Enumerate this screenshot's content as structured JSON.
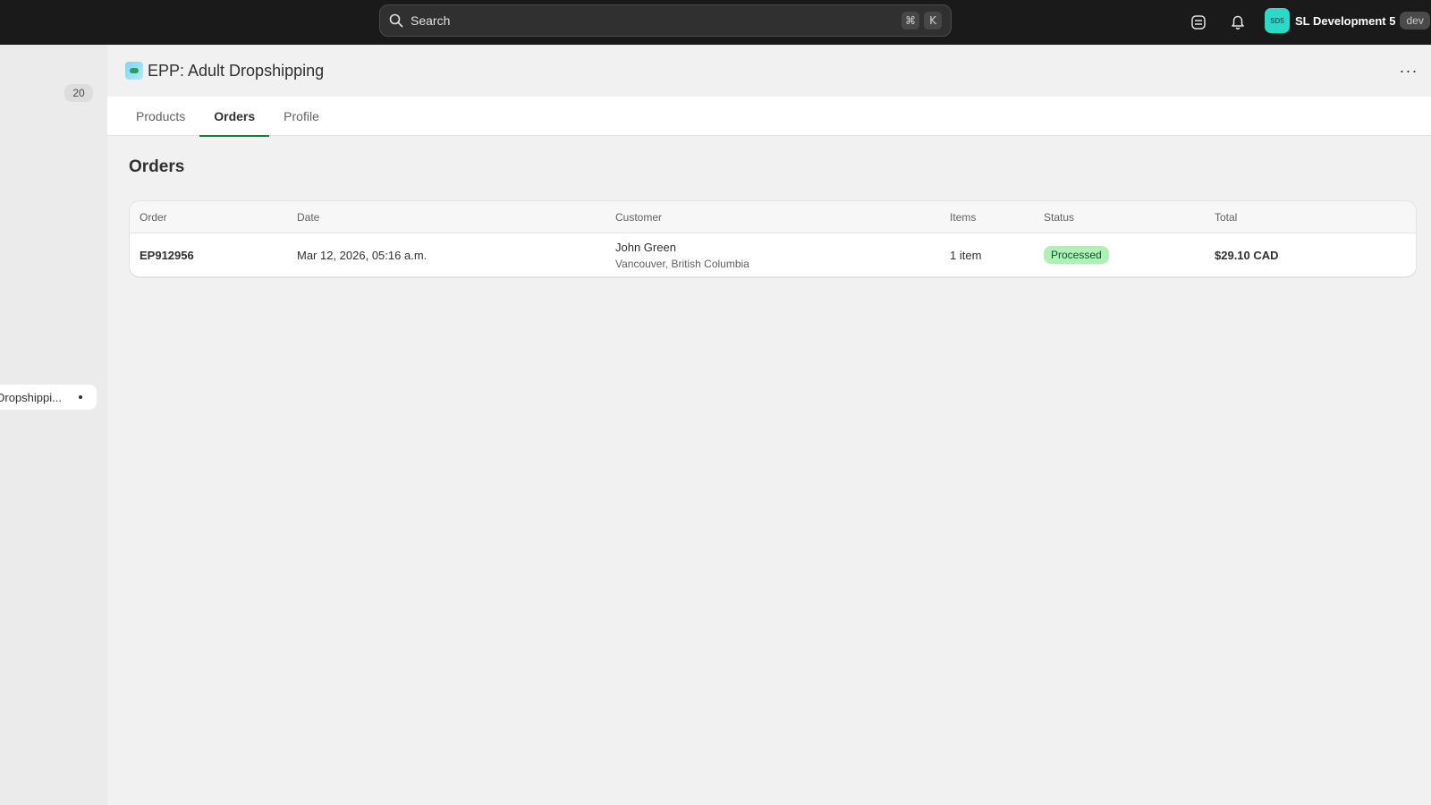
{
  "topbar": {
    "search_label": "Search",
    "shortcut_cmd": "⌘",
    "shortcut_key": "K",
    "store_initials": "SD5",
    "store_name": "SL Development 5",
    "store_badge": "dev"
  },
  "sidebar": {
    "count_badge": "20",
    "app_item_label": "Dropshippi..."
  },
  "app": {
    "title": "EPP: Adult Dropshipping",
    "more_label": "···"
  },
  "tabs": [
    {
      "label": "Products",
      "active": false
    },
    {
      "label": "Orders",
      "active": true
    },
    {
      "label": "Profile",
      "active": false
    }
  ],
  "orders": {
    "heading": "Orders",
    "columns": [
      "Order",
      "Date",
      "Customer",
      "Items",
      "Status",
      "Total"
    ],
    "rows": [
      {
        "order": "EP912956",
        "date": "Mar 12, 2026, 05:16 a.m.",
        "customer_name": "John Green",
        "customer_location": "Vancouver, British Columbia",
        "items": "1 item",
        "status": "Processed",
        "total": "$29.10 CAD"
      }
    ]
  },
  "colors": {
    "topbar": "#1a1a1a",
    "tab_active_underline": "#1a7a3e",
    "status_badge_bg": "#aff0b5",
    "status_badge_text": "#0c5132",
    "store_avatar": "#2ad9c8"
  }
}
